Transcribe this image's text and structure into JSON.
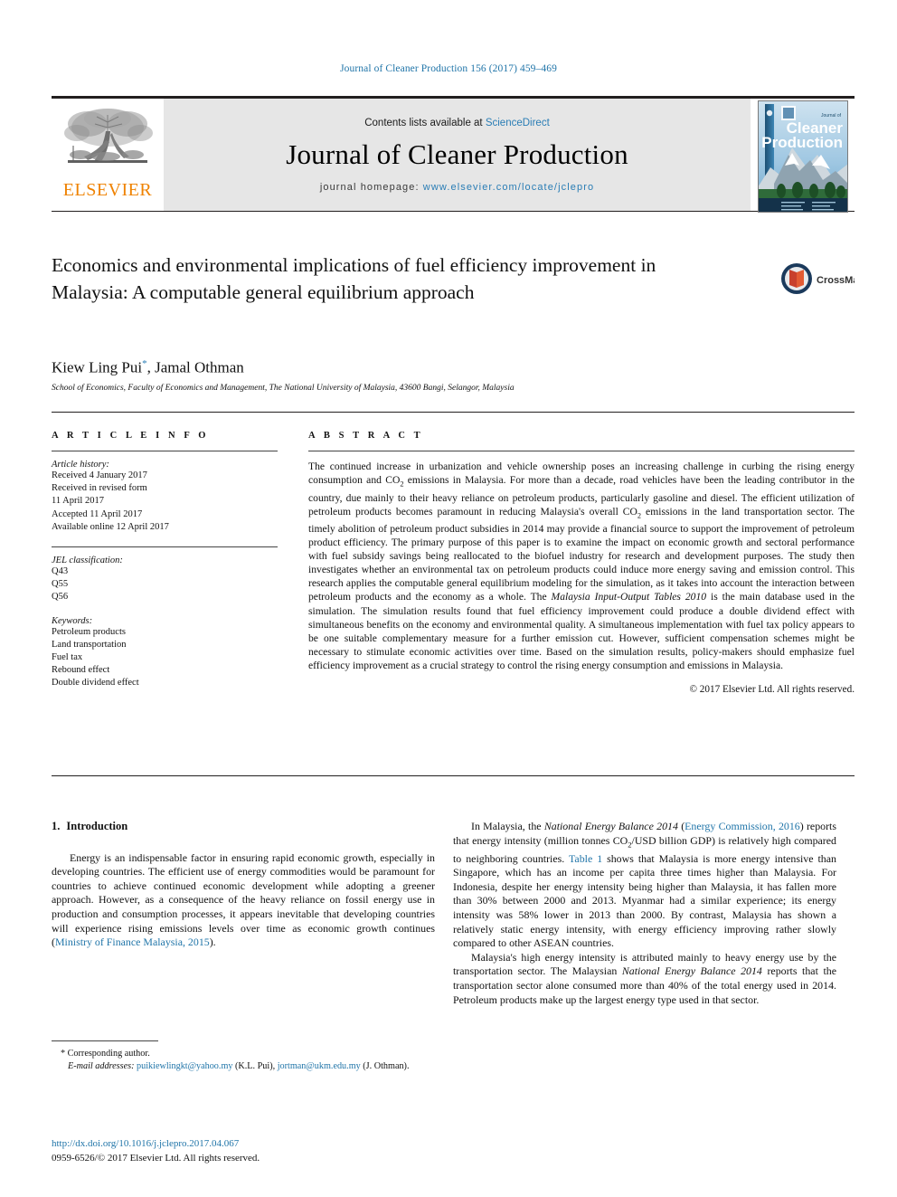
{
  "running_head": "Journal of Cleaner Production 156 (2017) 459–469",
  "masthead": {
    "publisher_name": "ELSEVIER",
    "contents_prefix": "Contents lists available at ",
    "contents_link": "ScienceDirect",
    "journal_title": "Journal of Cleaner Production",
    "homepage_prefix": "journal homepage: ",
    "homepage_url": "www.elsevier.com/locate/jclepro",
    "cover_title_line1": "Cleaner",
    "cover_title_line2": "Production",
    "cover_kicker": "Journal of"
  },
  "article": {
    "title": "Economics and environmental implications of fuel efficiency improvement in Malaysia: A computable general equilibrium approach",
    "authors": "Kiew Ling Pui",
    "authors_rest": ", Jamal Othman",
    "corresponding_marker": "*",
    "affiliation": "School of Economics, Faculty of Economics and Management, The National University of Malaysia, 43600 Bangi, Selangor, Malaysia",
    "crossmark_label": "CrossMark"
  },
  "article_info": {
    "section_label": "A R T I C L E   I N F O",
    "history_label": "Article history:",
    "history": [
      "Received 4 January 2017",
      "Received in revised form",
      "11 April 2017",
      "Accepted 11 April 2017",
      "Available online 12 April 2017"
    ],
    "jel_label": "JEL classification:",
    "jel_codes": [
      "Q43",
      "Q55",
      "Q56"
    ],
    "keywords_label": "Keywords:",
    "keywords": [
      "Petroleum products",
      "Land transportation",
      "Fuel tax",
      "Rebound effect",
      "Double dividend effect"
    ]
  },
  "abstract": {
    "section_label": "A B S T R A C T",
    "p1_a": "The continued increase in urbanization and vehicle ownership poses an increasing challenge in curbing the rising energy consumption and CO",
    "p1_b": " emissions in Malaysia. For more than a decade, road vehicles have been the leading contributor in the country, due mainly to their heavy reliance on petroleum products, particularly gasoline and diesel. The efficient utilization of petroleum products becomes paramount in reducing Malaysia's overall CO",
    "p1_c": " emissions in the land transportation sector. The timely abolition of petroleum product subsidies in 2014 may provide a financial source to support the improvement of petroleum product efficiency. The primary purpose of this paper is to examine the impact on economic growth and sectoral performance with fuel subsidy savings being reallocated to the biofuel industry for research and development purposes. The study then investigates whether an environmental tax on petroleum products could induce more energy saving and emission control. This research applies the computable general equilibrium modeling for the simulation, as it takes into account the interaction between petroleum products and the economy as a whole. The ",
    "p1_italic": "Malaysia Input-Output Tables 2010",
    "p1_d": " is the main database used in the simulation. The simulation results found that fuel efficiency improvement could produce a double dividend effect with simultaneous benefits on the economy and environmental quality. A simultaneous implementation with fuel tax policy appears to be one suitable complementary measure for a further emission cut. However, sufficient compensation schemes might be necessary to stimulate economic activities over time. Based on the simulation results, policy-makers should emphasize fuel efficiency improvement as a crucial strategy to control the rising energy consumption and emissions in Malaysia.",
    "subscript": "2",
    "copyright": "© 2017 Elsevier Ltd. All rights reserved."
  },
  "body": {
    "section_number": "1.",
    "section_title": "Introduction",
    "left_p1": "Energy is an indispensable factor in ensuring rapid economic growth, especially in developing countries. The efficient use of energy commodities would be paramount for countries to achieve continued economic development while adopting a greener approach. However, as a consequence of the heavy reliance on fossil energy use in production and consumption processes, it appears inevitable that developing countries will experience rising emissions levels over time as economic growth continues (",
    "left_p1_ref": "Ministry of Finance Malaysia, 2015",
    "left_p1_end": ").",
    "right_p1_a": "In Malaysia, the ",
    "right_p1_italic1": "National Energy Balance 2014",
    "right_p1_b": " (",
    "right_p1_ref1": "Energy Commission, 2016",
    "right_p1_c": ") reports that energy intensity (million tonnes CO",
    "right_p1_sub": "2",
    "right_p1_d": "/USD billion GDP) is relatively high compared to neighboring countries. ",
    "right_p1_ref2": "Table 1",
    "right_p1_e": " shows that Malaysia is more energy intensive than Singapore, which has an income per capita three times higher than Malaysia. For Indonesia, despite her energy intensity being higher than Malaysia, it has fallen more than 30% between 2000 and 2013. Myanmar had a similar experience; its energy intensity was 58% lower in 2013 than 2000. By contrast, Malaysia has shown a relatively static energy intensity, with energy efficiency improving rather slowly compared to other ASEAN countries.",
    "right_p2_a": "Malaysia's high energy intensity is attributed mainly to heavy energy use by the transportation sector. The Malaysian ",
    "right_p2_italic": "National Energy Balance 2014",
    "right_p2_b": " reports that the transportation sector alone consumed more than 40% of the total energy used in 2014. Petroleum products make up the largest energy type used in that sector."
  },
  "footer": {
    "corresponding_marker": "*",
    "corresponding_label": "Corresponding author.",
    "email_label": "E-mail addresses:",
    "email1": "puikiewlingkt@yahoo.my",
    "email1_owner": "(K.L. Pui),",
    "email2": "jortman@ukm.edu.my",
    "email2_owner": "(J. Othman).",
    "doi": "http://dx.doi.org/10.1016/j.jclepro.2017.04.067",
    "issn_line": "0959-6526/© 2017 Elsevier Ltd. All rights reserved."
  },
  "colors": {
    "link": "#1f74a8",
    "elsevier_orange": "#ef8200",
    "masthead_bg": "#e6e6e6",
    "rule": "#221f1f"
  }
}
